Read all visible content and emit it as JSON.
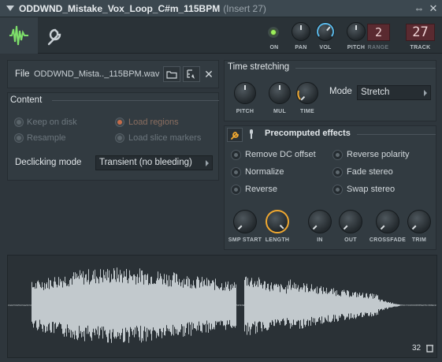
{
  "window": {
    "title": "ODDWND_Mistake_Vox_Loop_C#m_115BPM",
    "insert": "(Insert 27)"
  },
  "header": {
    "labels": {
      "on": "ON",
      "pan": "PAN",
      "vol": "VOL",
      "pitch": "PITCH",
      "range": "RANGE",
      "track": "TRACK"
    },
    "range_value": "2",
    "track_value": "27"
  },
  "file": {
    "label": "File",
    "name": "ODDWND_Mista.._115BPM.wav"
  },
  "content": {
    "title": "Content",
    "options": [
      {
        "label": "Keep on disk"
      },
      {
        "label": "Load regions"
      },
      {
        "label": "Resample"
      },
      {
        "label": "Load slice markers"
      }
    ],
    "declicking": {
      "label": "Declicking mode",
      "value": "Transient (no bleeding)"
    }
  },
  "time_stretching": {
    "title": "Time stretching",
    "knobs": [
      "PITCH",
      "MUL",
      "TIME"
    ],
    "mode_label": "Mode",
    "mode_value": "Stretch"
  },
  "precomputed": {
    "title": "Precomputed effects",
    "effects": [
      "Remove DC offset",
      "Reverse polarity",
      "Normalize",
      "Fade stereo",
      "Reverse",
      "Swap stereo"
    ],
    "knobs": [
      "SMP START",
      "LENGTH",
      "IN",
      "OUT",
      "CROSSFADE",
      "TRIM"
    ]
  },
  "waveform": {
    "zoom_value": "32"
  },
  "colors": {
    "accent": "#f0a830",
    "led": "#9cf05a",
    "lcd": "#5a2a30"
  }
}
